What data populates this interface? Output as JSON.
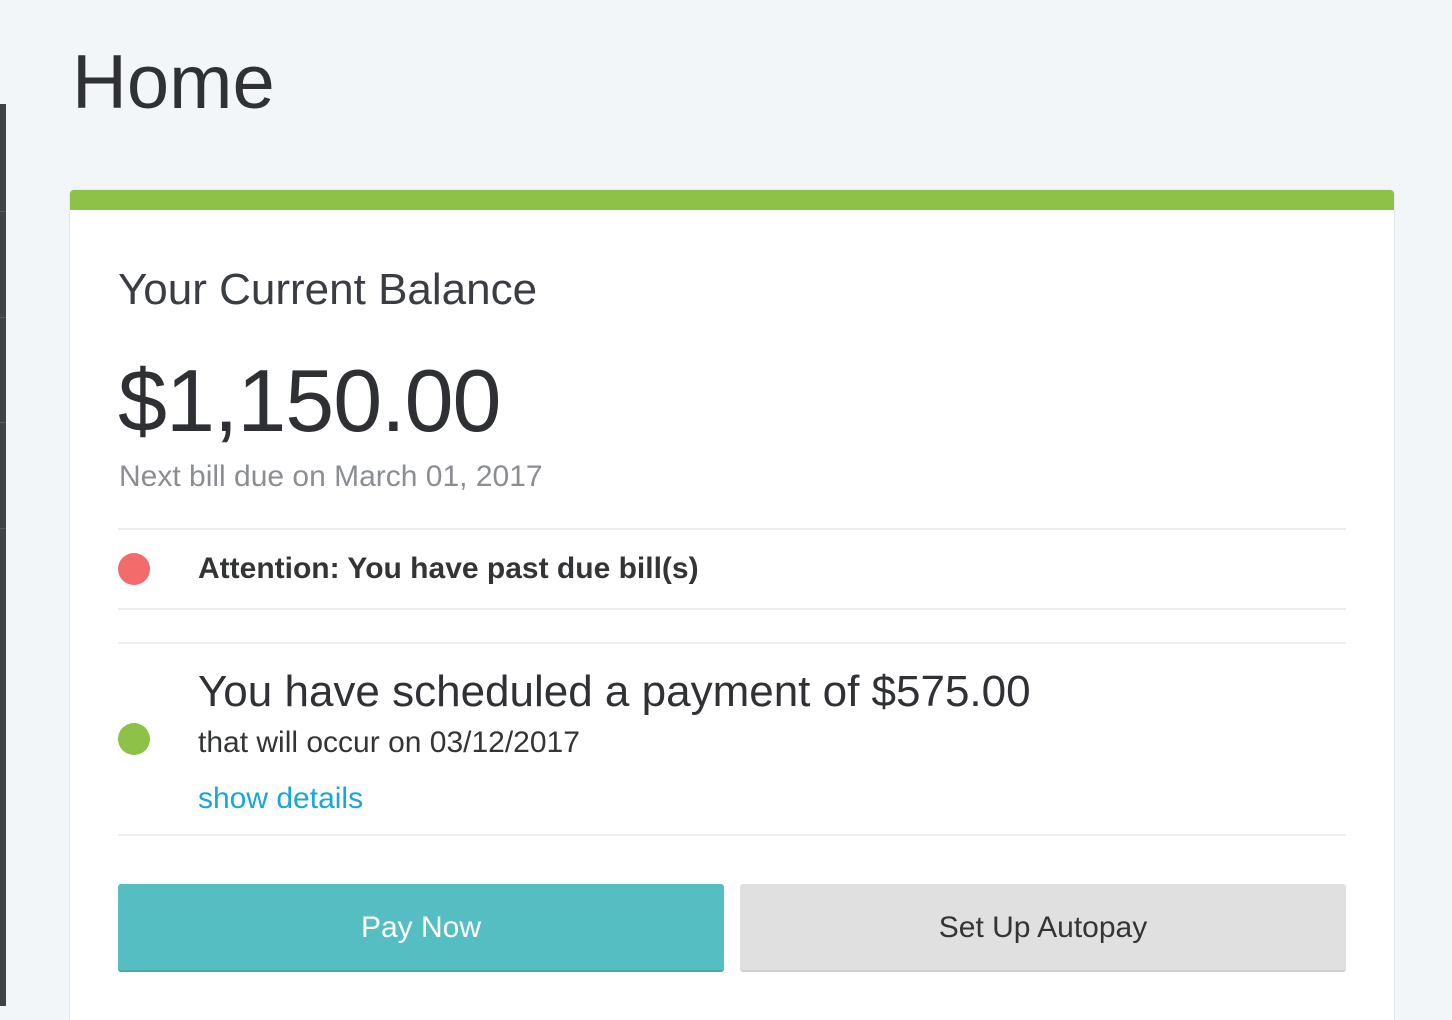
{
  "page": {
    "title": "Home"
  },
  "balance_card": {
    "label": "Your Current Balance",
    "amount": "$1,150.00",
    "next_bill": "Next bill due on March 01, 2017",
    "accent_color": "#8dc147"
  },
  "alerts": [
    {
      "status": "past-due",
      "color": "#f46b6b",
      "text": "Attention: You have past due bill(s)"
    },
    {
      "status": "scheduled",
      "color": "#8dc147",
      "text": "You have scheduled a payment of $575.00",
      "subtext": "that will occur on 03/12/2017",
      "link_label": "show details"
    }
  ],
  "actions": {
    "pay_now_label": "Pay Now",
    "autopay_label": "Set Up Autopay",
    "pay_now_color": "#55bec3",
    "autopay_color": "#e0e0e0"
  }
}
